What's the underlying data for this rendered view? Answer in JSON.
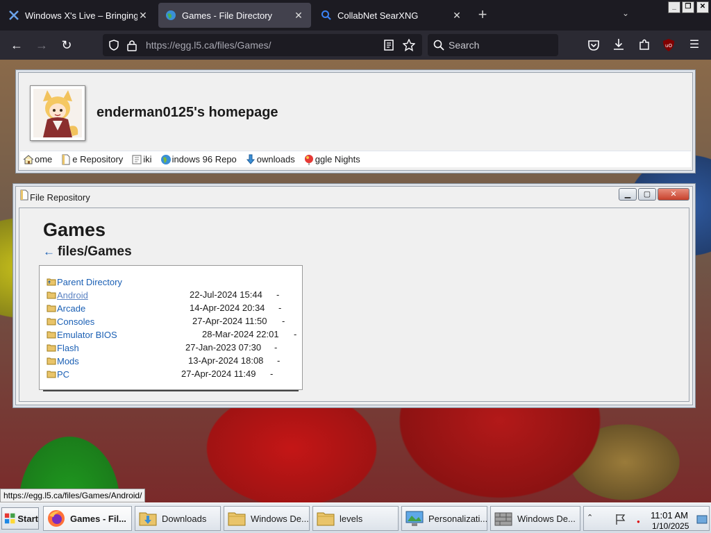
{
  "browser": {
    "tabs": [
      {
        "title": "Windows X's Live – Bringing tha",
        "active": false
      },
      {
        "title": "Games - File Directory",
        "active": true
      },
      {
        "title": "CollabNet SearXNG",
        "active": false
      }
    ],
    "url": "https://egg.l5.ca/files/Games/",
    "search_placeholder": "Search"
  },
  "site": {
    "title": "enderman0125's homepage",
    "nav": [
      {
        "label": "ome",
        "icon": "home-icon"
      },
      {
        "label": "e Repository",
        "icon": "file-icon"
      },
      {
        "label": "iki",
        "icon": "wiki-book-icon"
      },
      {
        "label": "indows 96 Repo",
        "icon": "globe-icon"
      },
      {
        "label": "ownloads",
        "icon": "download-arrow-icon"
      },
      {
        "label": "ggle Nights",
        "icon": "balloon-icon"
      }
    ]
  },
  "repo_window": {
    "title": "File Repository",
    "heading": "Games",
    "back_arrow": "←",
    "path": "files/Games",
    "parent_label": "Parent Directory",
    "entries": [
      {
        "name": "Android",
        "date": "22-Jul-2024 15:44",
        "size": "-"
      },
      {
        "name": "Arcade",
        "date": "14-Apr-2024 20:34",
        "size": "-"
      },
      {
        "name": "Consoles",
        "date": "27-Apr-2024 11:50",
        "size": "-"
      },
      {
        "name": "Emulator BIOS",
        "date": "28-Mar-2024 22:01",
        "size": "-"
      },
      {
        "name": "Flash",
        "date": "27-Jan-2023 07:30",
        "size": "-"
      },
      {
        "name": "Mods",
        "date": "13-Apr-2024 18:08",
        "size": "-"
      },
      {
        "name": "PC",
        "date": "27-Apr-2024 11:49",
        "size": "-"
      }
    ]
  },
  "status_link": "https://egg.l5.ca/files/Games/Android/",
  "taskbar": {
    "start_label": "Start",
    "tasks": [
      {
        "label": "Games - Fil...",
        "icon": "firefox-icon",
        "active": true
      },
      {
        "label": "Downloads",
        "icon": "downloads-folder-icon",
        "active": false
      },
      {
        "label": "Windows De...",
        "icon": "folder-icon",
        "active": false
      },
      {
        "label": "levels",
        "icon": "folder-icon",
        "active": false
      },
      {
        "label": "Personalizati...",
        "icon": "display-settings-icon",
        "active": false
      },
      {
        "label": "Windows De...",
        "icon": "firewall-icon",
        "active": false
      }
    ],
    "clock_time": "11:01 AM",
    "clock_date": "1/10/2025"
  }
}
